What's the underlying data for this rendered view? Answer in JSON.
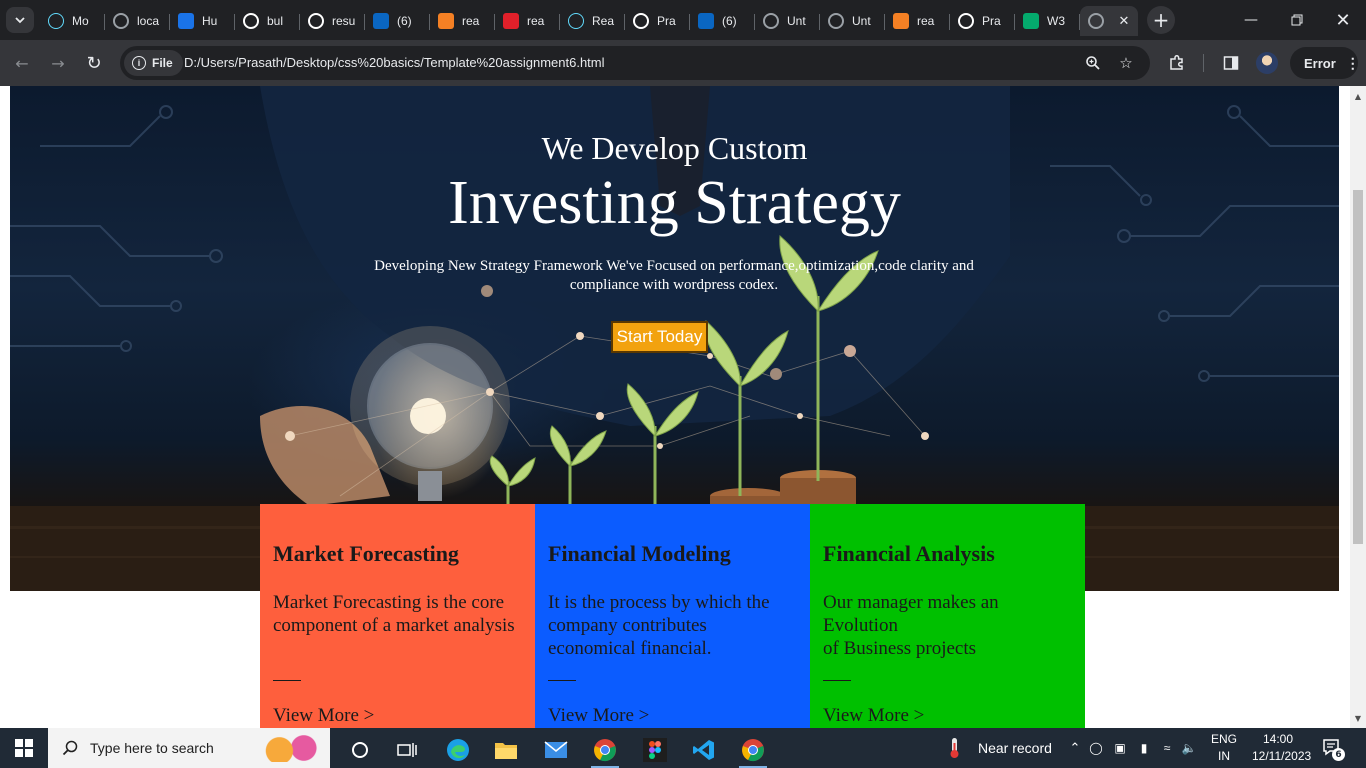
{
  "browser": {
    "tabs": [
      {
        "title": "Mo",
        "icon": "react-icon",
        "color": "#61dafb"
      },
      {
        "title": "loca",
        "icon": "globe-gear-icon",
        "color": "#9aa0a6"
      },
      {
        "title": "Hu",
        "icon": "hubspot-h-icon",
        "color": "#1a73e8"
      },
      {
        "title": "bul",
        "icon": "google-icon",
        "color": "#ffffff"
      },
      {
        "title": "resu",
        "icon": "google-icon",
        "color": "#ffffff"
      },
      {
        "title": "(6)",
        "icon": "linkedin-icon",
        "color": "#0a66c2"
      },
      {
        "title": "rea",
        "icon": "stack-overflow-icon",
        "color": "#f48024"
      },
      {
        "title": "rea",
        "icon": "n-logo-icon",
        "color": "#e0202a"
      },
      {
        "title": "Rea",
        "icon": "react-icon",
        "color": "#61dafb"
      },
      {
        "title": "Pra",
        "icon": "github-icon",
        "color": "#ffffff"
      },
      {
        "title": "(6)",
        "icon": "linkedin-icon",
        "color": "#0a66c2"
      },
      {
        "title": "Unt",
        "icon": "globe-icon",
        "color": "#9aa0a6"
      },
      {
        "title": "Unt",
        "icon": "globe-icon",
        "color": "#9aa0a6"
      },
      {
        "title": "rea",
        "icon": "stack-overflow-icon",
        "color": "#f48024"
      },
      {
        "title": "Pra",
        "icon": "github-icon",
        "color": "#ffffff"
      },
      {
        "title": "W3",
        "icon": "w3schools-icon",
        "color": "#04aa6d"
      }
    ],
    "active_tab_icon": "globe-icon",
    "address": {
      "chip_label": "File",
      "url": "D:/Users/Prasath/Desktop/css%20basics/Template%20assignment6.html"
    },
    "error_label": "Error"
  },
  "page": {
    "hero": {
      "subtitle": "We Develop Custom",
      "title": "Investing Strategy",
      "description": "Developing New Strategy Framework We've Focused on performance,optimization,code clarity and compliance with wordpress codex.",
      "cta_label": "Start Today"
    },
    "cards": [
      {
        "title": "Market Forecasting",
        "body": "Market Forecasting is the core component of a market analysis",
        "link": "View More >",
        "color": "#fe5f3d"
      },
      {
        "title": "Financial Modeling",
        "body": "It is the process by which the company contributes economical financial.",
        "link": "View More >",
        "color": "#0b5cff"
      },
      {
        "title": "Financial Analysis",
        "body": "Our manager makes an\nEvolution\nof Business projects",
        "link": "View More >",
        "color": "#00c000"
      }
    ]
  },
  "taskbar": {
    "search_placeholder": "Type here to search",
    "weather": "Near record",
    "lang_top": "ENG",
    "lang_bottom": "IN",
    "time": "14:00",
    "date": "12/11/2023",
    "notification_count": "6"
  }
}
